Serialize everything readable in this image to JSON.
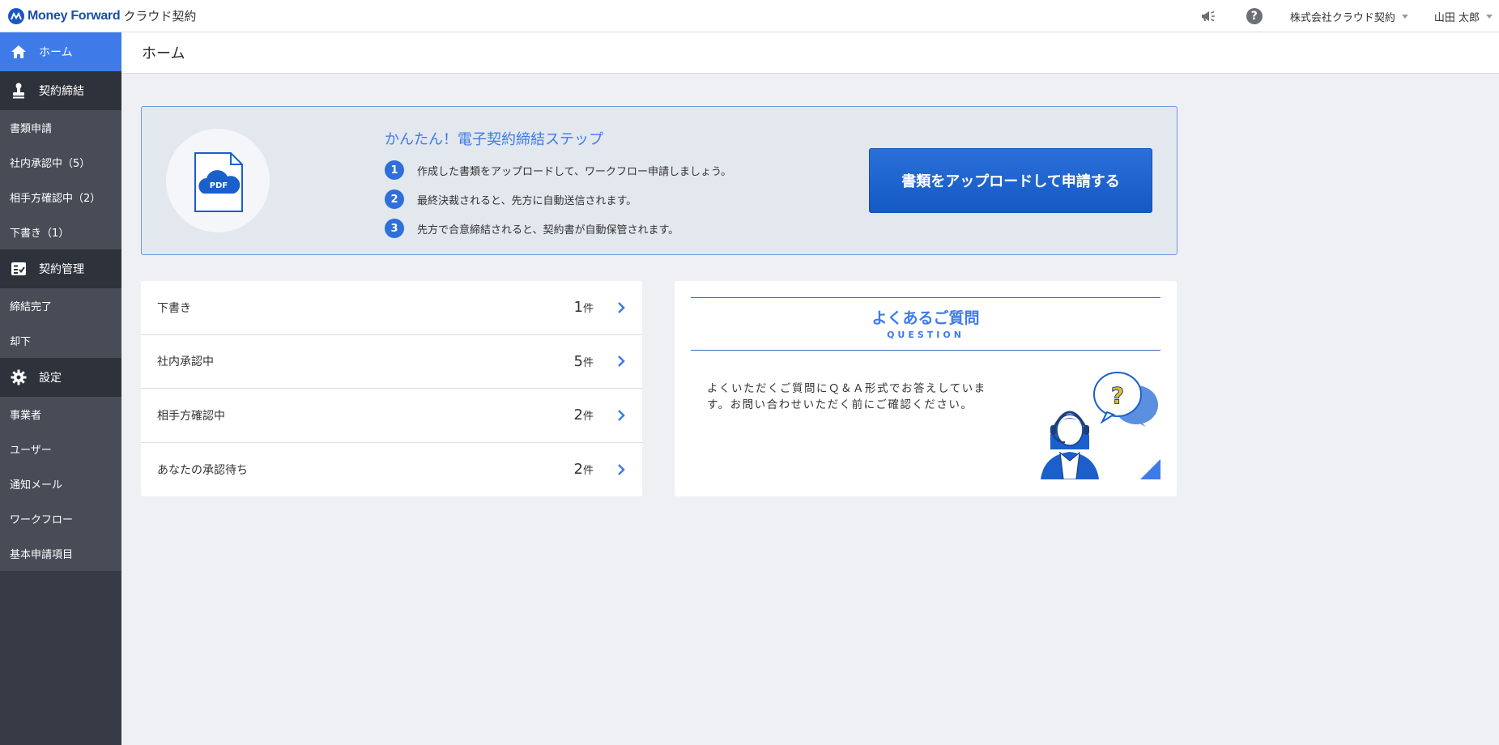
{
  "header": {
    "logo_text": "Money Forward",
    "logo_sub": "クラウド契約",
    "company": "株式会社クラウド契約",
    "user": "山田 太郎",
    "icons": [
      "megaphone-icon",
      "help-icon"
    ]
  },
  "sidebar": {
    "home": "ホーム",
    "contract_sign": "契約締結",
    "contract_sign_items": [
      "書類申請",
      "社内承認中（5）",
      "相手方確認中（2）",
      "下書き（1）"
    ],
    "contract_manage": "契約管理",
    "contract_manage_items": [
      "締結完了",
      "却下"
    ],
    "settings": "設定",
    "settings_items": [
      "事業者",
      "ユーザー",
      "通知メール",
      "ワークフロー",
      "基本申請項目"
    ]
  },
  "page": {
    "title": "ホーム"
  },
  "upload_panel": {
    "pdf_label": "PDF",
    "steps_title": "かんたん！電子契約締結ステップ",
    "steps": [
      {
        "num": "1",
        "text": "作成した書類をアップロードして、ワークフロー申請しましょう。"
      },
      {
        "num": "2",
        "text": "最終決裁されると、先方に自動送信されます。"
      },
      {
        "num": "3",
        "text": "先方で合意締結されると、契約書が自動保管されます。"
      }
    ],
    "button_label": "書類をアップロードして申請する"
  },
  "status_list": [
    {
      "label": "下書き",
      "count": "1",
      "unit": "件"
    },
    {
      "label": "社内承認中",
      "count": "5",
      "unit": "件"
    },
    {
      "label": "相手方確認中",
      "count": "2",
      "unit": "件"
    },
    {
      "label": "あなたの承認待ち",
      "count": "2",
      "unit": "件"
    }
  ],
  "faq": {
    "title": "よくあるご質問",
    "subtitle": "QUESTION",
    "text": "よくいただくご質問にＱ＆Ａ形式でお答えしています。お問い合わせいただく前にご確認ください。",
    "bubble_mark": "?"
  },
  "colors": {
    "accent": "#3f7be8",
    "sidebar": "#363b45",
    "button": "#1a5fcc"
  }
}
